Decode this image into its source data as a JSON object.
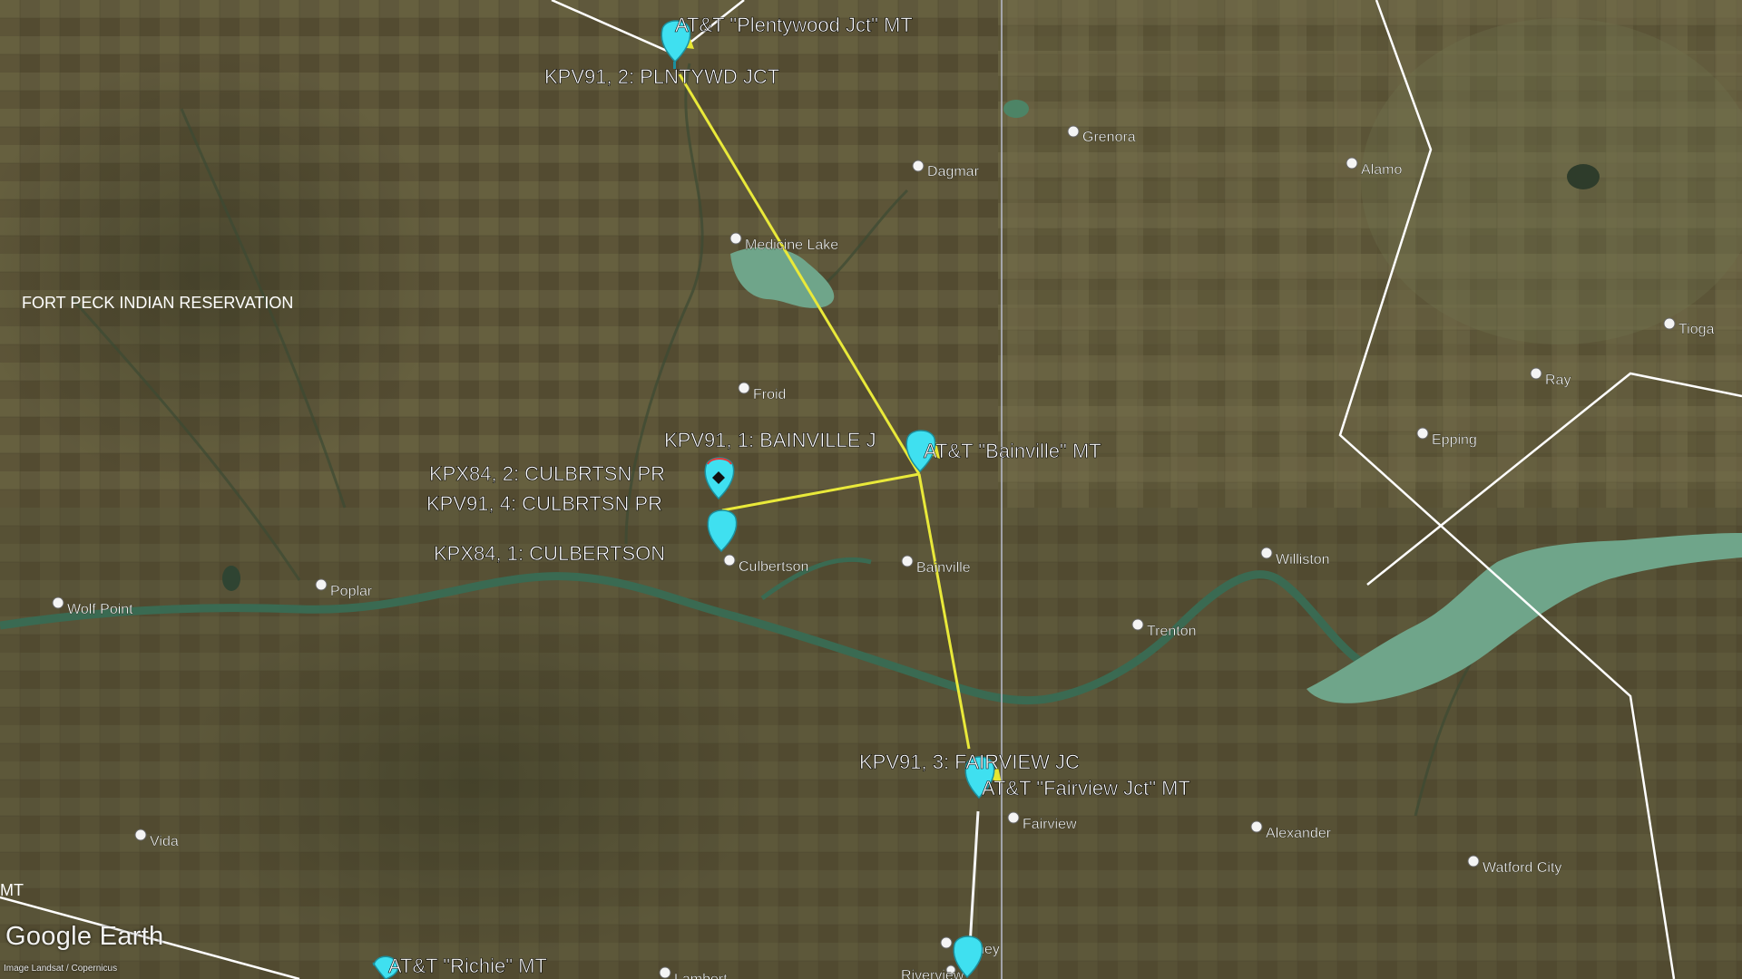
{
  "map": {
    "logo": "Google Earth",
    "attribution": "Image Landsat / Copernicus",
    "colors": {
      "route": "#e9e93a",
      "route_white": "#f4f4f4",
      "boundary": "#ffffff",
      "pin": "#3fe0f0",
      "water": "#6fa58a",
      "river": "#3f6b54",
      "land": "#5b5338"
    }
  },
  "region_labels": [
    {
      "id": "fort-peck",
      "text": "FORT PECK INDIAN RESERVATION"
    },
    {
      "id": "mt-edge",
      "text": "MT"
    }
  ],
  "towns": [
    {
      "id": "grenora",
      "name": "Grenora"
    },
    {
      "id": "dagmar",
      "name": "Dagmar"
    },
    {
      "id": "alamo",
      "name": "Alamo"
    },
    {
      "id": "medicine-lake",
      "name": "Medicine Lake"
    },
    {
      "id": "tioga",
      "name": "Tioga"
    },
    {
      "id": "ray",
      "name": "Ray"
    },
    {
      "id": "froid",
      "name": "Froid"
    },
    {
      "id": "epping",
      "name": "Epping"
    },
    {
      "id": "williston",
      "name": "Williston"
    },
    {
      "id": "culbertson",
      "name": "Culbertson"
    },
    {
      "id": "bainville",
      "name": "Bainville"
    },
    {
      "id": "poplar",
      "name": "Poplar"
    },
    {
      "id": "wolf-point",
      "name": "Wolf Point"
    },
    {
      "id": "trenton",
      "name": "Trenton"
    },
    {
      "id": "fairview",
      "name": "Fairview"
    },
    {
      "id": "alexander",
      "name": "Alexander"
    },
    {
      "id": "watford-city",
      "name": "Watford City"
    },
    {
      "id": "vida",
      "name": "Vida"
    },
    {
      "id": "sidney",
      "name": "Sidney"
    },
    {
      "id": "riverview",
      "name": "Riverview"
    },
    {
      "id": "lambert",
      "name": "Lambert"
    }
  ],
  "placemarks": [
    {
      "id": "plentywood-att",
      "label": "AT&T \"Plentywood Jct\" MT"
    },
    {
      "id": "plentywood-kpv",
      "label": "KPV91, 2: PLNTYWD JCT"
    },
    {
      "id": "bainville-kpv",
      "label": "KPV91, 1: BAINVILLE J"
    },
    {
      "id": "bainville-att",
      "label": "AT&T \"Bainville\" MT"
    },
    {
      "id": "culbertson-kpx2",
      "label": "KPX84, 2: CULBRTSN PR"
    },
    {
      "id": "culbertson-kpv4",
      "label": "KPV91, 4: CULBRTSN PR"
    },
    {
      "id": "culbertson-kpx1",
      "label": "KPX84, 1: CULBERTSON"
    },
    {
      "id": "fairview-kpv",
      "label": "KPV91, 3: FAIRVIEW JC"
    },
    {
      "id": "fairview-att",
      "label": "AT&T \"Fairview Jct\" MT"
    },
    {
      "id": "richie-att",
      "label": "AT&T \"Richie\" MT"
    }
  ]
}
